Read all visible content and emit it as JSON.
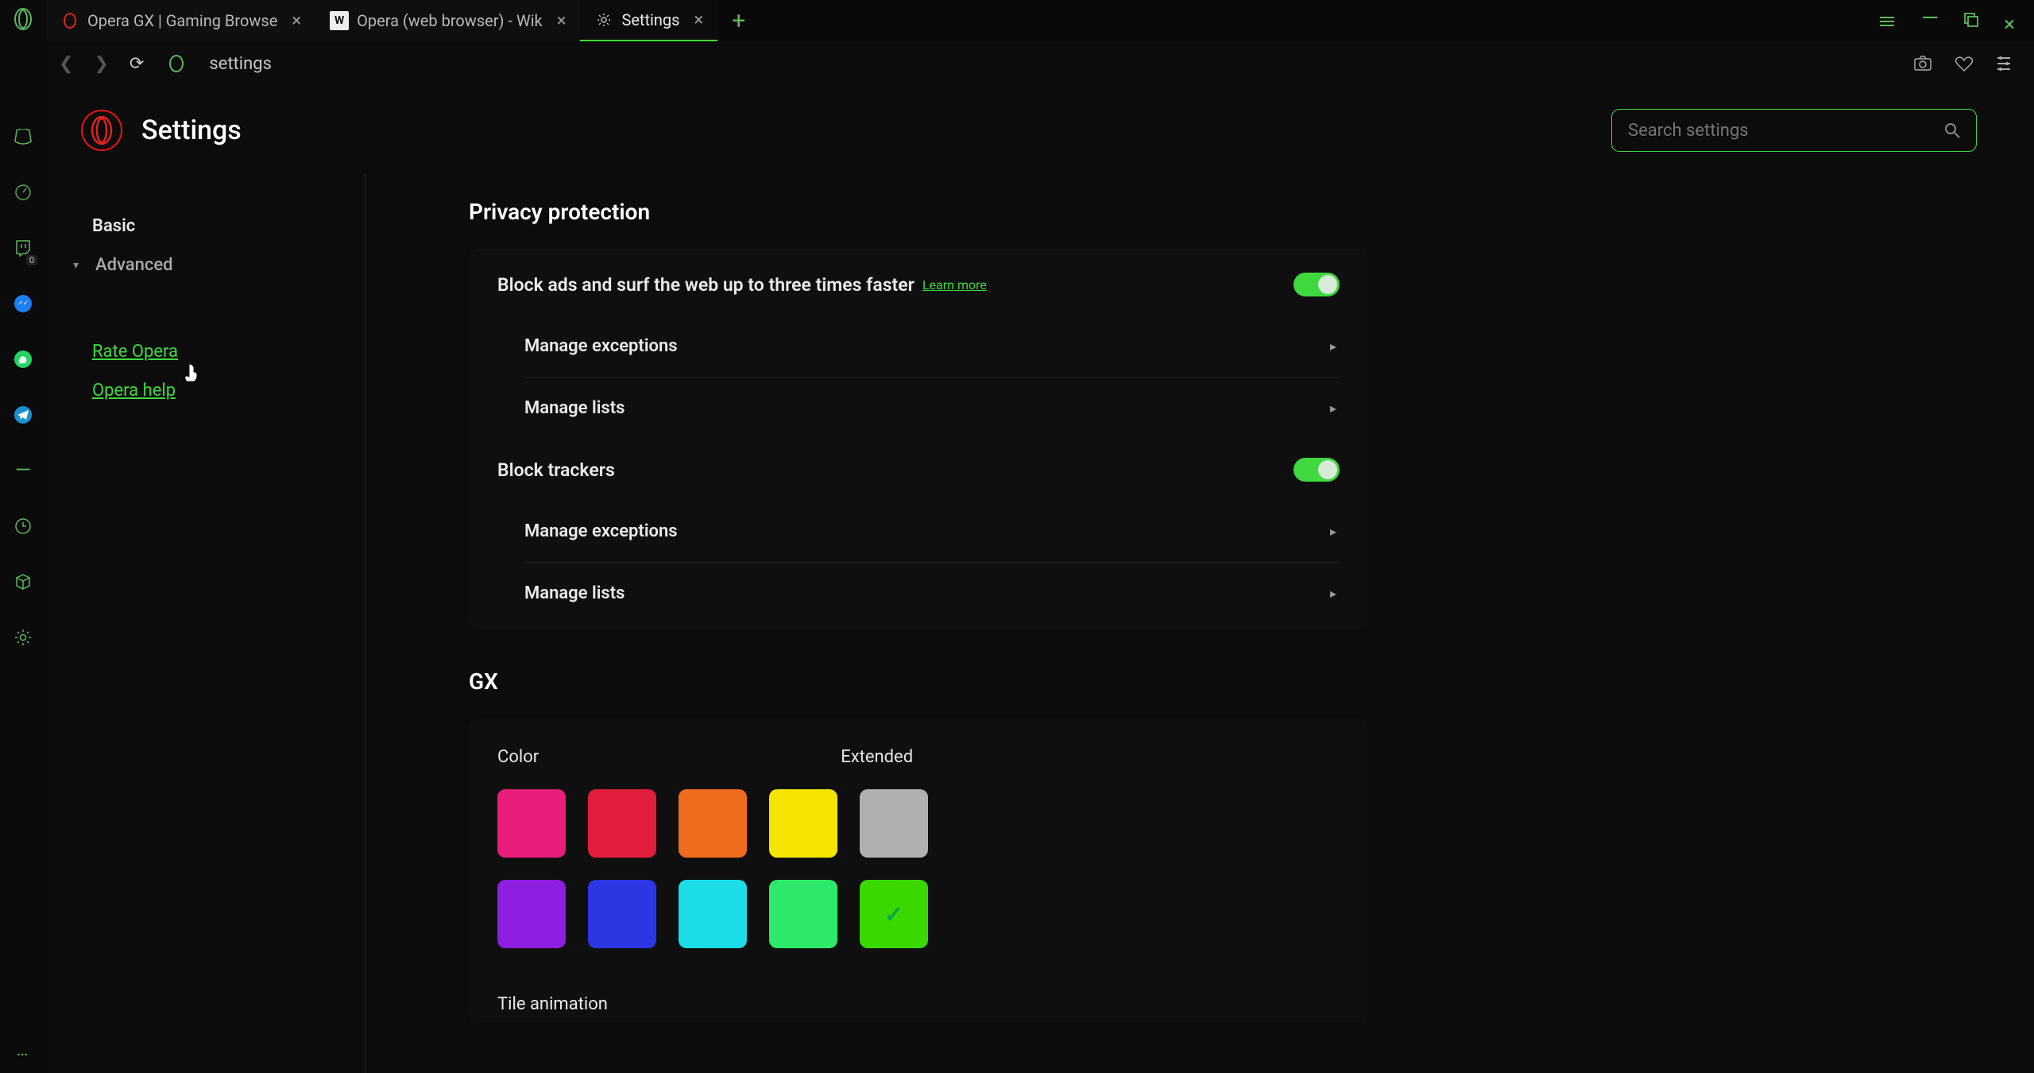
{
  "tabs": [
    {
      "title": "Opera GX | Gaming Browse"
    },
    {
      "title": "Opera (web browser) - Wik"
    },
    {
      "title": "Settings"
    }
  ],
  "addr": {
    "text": "settings"
  },
  "page": {
    "title": "Settings",
    "search_placeholder": "Search settings"
  },
  "nav": {
    "basic": "Basic",
    "advanced": "Advanced",
    "rate": "Rate Opera",
    "help": "Opera help"
  },
  "privacy": {
    "heading": "Privacy protection",
    "block_ads_label": "Block ads and surf the web up to three times faster",
    "learn_more": "Learn more",
    "manage_exceptions": "Manage exceptions",
    "manage_lists": "Manage lists",
    "block_trackers": "Block trackers"
  },
  "gx": {
    "heading": "GX",
    "color_label": "Color",
    "extended": "Extended",
    "swatches": [
      "#e91e7a",
      "#e11e3c",
      "#ef6c1f",
      "#f5e400",
      "#b0b0b0",
      "#8e1ee0",
      "#2d36e3",
      "#1bdce7",
      "#2de86a",
      "#3bd800"
    ],
    "selected_index": 9,
    "tile_animation": "Tile animation"
  },
  "sidebar_badge": "0"
}
